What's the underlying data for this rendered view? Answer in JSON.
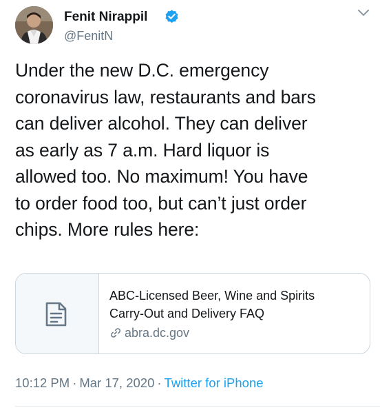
{
  "author": {
    "name": "Fenit Nirappil",
    "handle": "@FenitN",
    "verified": true
  },
  "tweet": {
    "text": "Under the new D.C. emergency\ncoronavirus law, restaurants and bars\ncan deliver alcohol. They can deliver\nas early as 7 a.m. Hard liquor is\nallowed too. No maximum! You have\nto order food too, but can’t just order\nchips. More rules here:"
  },
  "link_card": {
    "title": "ABC-Licensed Beer, Wine and Spirits\nCarry-Out and Delivery FAQ",
    "domain": "abra.dc.gov",
    "thumb_icon": "document-icon",
    "domain_icon": "link-icon"
  },
  "meta": {
    "time": "10:12 PM",
    "separator": "·",
    "date": "Mar 17, 2020",
    "source": "Twitter for iPhone"
  },
  "colors": {
    "accent": "#1da1f2",
    "text": "#14171a",
    "secondary": "#657786",
    "border": "#ccd6dd"
  },
  "icons": {
    "verified": "verified-badge-icon",
    "more": "chevron-down-icon"
  }
}
